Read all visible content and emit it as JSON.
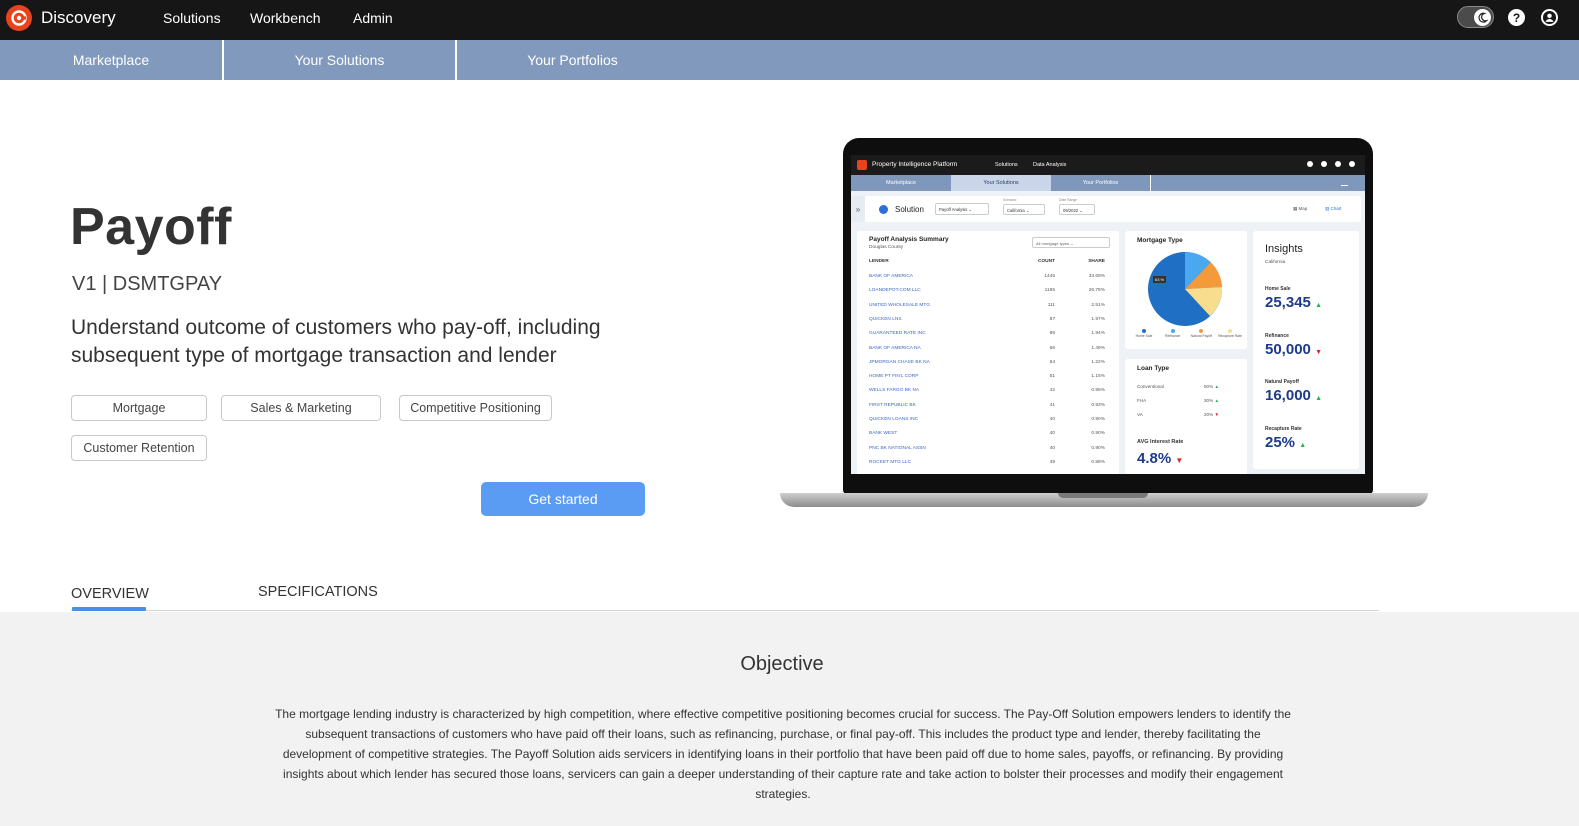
{
  "topbar": {
    "brand": "Discovery",
    "nav": [
      "Solutions",
      "Workbench",
      "Admin"
    ]
  },
  "subnav": {
    "tabs": [
      "Marketplace",
      "Your Solutions",
      "Your Portfolios"
    ]
  },
  "hero": {
    "title": "Payoff",
    "version": "V1 | DSMTGPAY",
    "description": "Understand outcome of customers who pay-off, including subsequent type of mortgage transaction and lender",
    "tags": [
      "Mortgage",
      "Sales & Marketing",
      "Competitive Positioning",
      "Customer Retention"
    ],
    "cta": "Get started"
  },
  "preview": {
    "app_title": "Property Intelligence Platform",
    "nav": [
      "Solutions",
      "Data Analysis"
    ],
    "tabs": [
      "Marketplace",
      "Your Solutions",
      "Your Portfolios"
    ],
    "toolbar": {
      "label": "Solution",
      "solution_value": "Payoff Analysis",
      "scenario_label": "Scenario",
      "scenario_value": "California",
      "date_label": "Date Range",
      "date_value": "09/2022",
      "map_label": "Map",
      "chart_label": "Chart"
    },
    "summary": {
      "title": "Payoff Analysis Summary",
      "subtitle": "Douglas County",
      "filter": "All mortgage types",
      "columns": [
        "LENDER",
        "COUNT",
        "SHARE"
      ],
      "rows": [
        {
          "lender": "BANK OF AMERICA",
          "count": "1445",
          "share": "33.69%"
        },
        {
          "lender": "LOANDEPOT.COM LLC",
          "count": "1185",
          "share": "26.78%"
        },
        {
          "lender": "UNITED WHOLESALE MTG",
          "count": "111",
          "share": "2.51%"
        },
        {
          "lender": "QUICKEN LNS",
          "count": "87",
          "share": "1.97%"
        },
        {
          "lender": "GUARANTEED RATE INC",
          "count": "86",
          "share": "1.94%"
        },
        {
          "lender": "BANK OF AMERICA NA",
          "count": "66",
          "share": "1.49%"
        },
        {
          "lender": "JPMORGAN CHASE BK NA",
          "count": "54",
          "share": "1.22%"
        },
        {
          "lender": "HOME PT FIN'L CORP",
          "count": "51",
          "share": "1.15%"
        },
        {
          "lender": "WELLS FARGO BK NA",
          "count": "42",
          "share": "0.95%"
        },
        {
          "lender": "FIRST REPUBLIC BK",
          "count": "41",
          "share": "0.93%"
        },
        {
          "lender": "QUICKEN LOANS INC",
          "count": "40",
          "share": "0.90%"
        },
        {
          "lender": "BANK WEST",
          "count": "40",
          "share": "0.90%"
        },
        {
          "lender": "PNC BK NATIONAL ASSN",
          "count": "40",
          "share": "0.90%"
        },
        {
          "lender": "ROCKET MTG LLC",
          "count": "39",
          "share": "0.88%"
        }
      ]
    },
    "mortgage_type": {
      "title": "Mortgage Type",
      "callout": "63 %",
      "legend": [
        "Home Sale",
        "Refinance",
        "Natural Payoff",
        "Recapture Rate"
      ],
      "colors": [
        "#1f6fc4",
        "#4aa8f0",
        "#f59a3a",
        "#f8dd8e"
      ]
    },
    "loan_type": {
      "title": "Loan Type",
      "rows": [
        {
          "label": "Conventional",
          "value": "50%",
          "dir": "up"
        },
        {
          "label": "FHA",
          "value": "30%",
          "dir": "up"
        },
        {
          "label": "VA",
          "value": "20%",
          "dir": "down"
        }
      ],
      "avg_label": "AVG Interest Rate",
      "avg_value": "4.8%"
    },
    "insights": {
      "title": "Insights",
      "subtitle": "California",
      "items": [
        {
          "label": "Home Sale",
          "value": "25,345",
          "dir": "up"
        },
        {
          "label": "Refinance",
          "value": "50,000",
          "dir": "down"
        },
        {
          "label": "Natural Payoff",
          "value": "16,000",
          "dir": "up"
        },
        {
          "label": "Recapture Rate",
          "value": "25%",
          "dir": "up"
        }
      ]
    }
  },
  "tabs": [
    "OVERVIEW",
    "SPECIFICATIONS"
  ],
  "objective": {
    "title": "Objective",
    "text": "The mortgage lending industry is characterized by high competition, where effective competitive positioning becomes crucial for success. The Pay-Off Solution empowers lenders to identify the subsequent transactions of customers who have paid off their loans, such as refinancing, purchase, or final pay-off. This includes the product type and lender, thereby facilitating the development of competitive strategies. The Payoff Solution aids servicers in identifying loans in their portfolio that have been paid off due to home sales, payoffs, or refinancing. By providing insights about which lender has secured those loans, servicers can gain a deeper understanding of their capture rate and take action to bolster their processes and modify their engagement strategies."
  },
  "colors": {
    "topbar": "#161616",
    "subbar": "#8199bd",
    "accent": "#5a9cf4",
    "brand": "#e8431f",
    "tab_underline": "#4a90e2"
  }
}
